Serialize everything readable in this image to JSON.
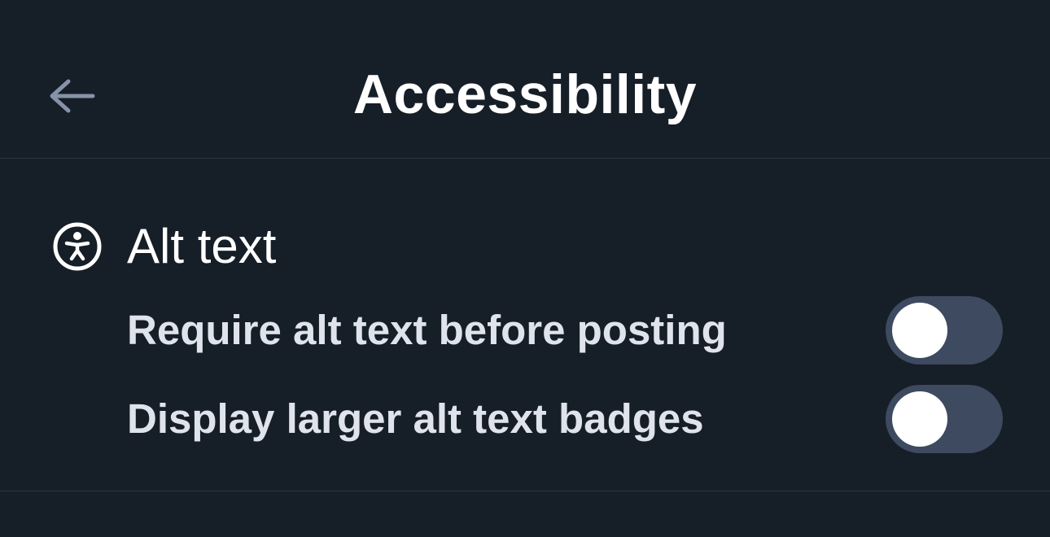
{
  "header": {
    "title": "Accessibility",
    "back_icon": "arrow-left-icon"
  },
  "section": {
    "title": "Alt text",
    "icon": "accessibility-icon",
    "settings": [
      {
        "label": "Require alt text before posting",
        "enabled": false
      },
      {
        "label": "Display larger alt text badges",
        "enabled": false
      }
    ]
  },
  "colors": {
    "background": "#161e27",
    "divider": "#2c3645",
    "toggle_track_off": "#3d4a5f",
    "toggle_knob": "#ffffff",
    "back_icon": "#8692a8",
    "title_text": "#ffffff",
    "label_text": "#dfe3ec"
  }
}
